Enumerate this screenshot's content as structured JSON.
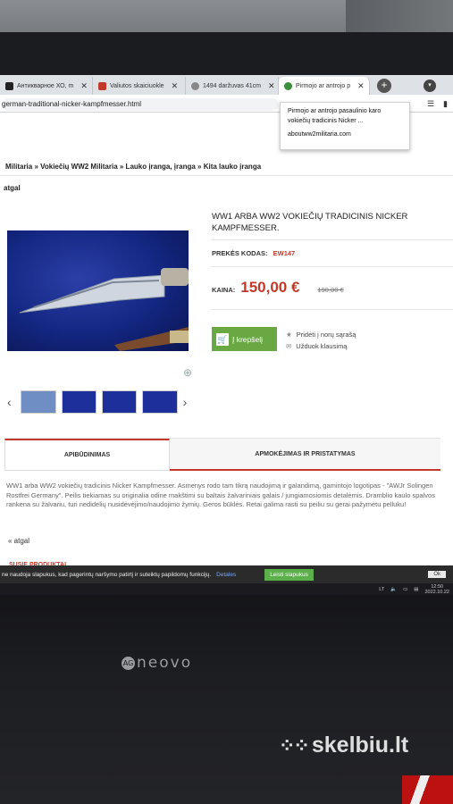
{
  "browser": {
    "tabs": [
      {
        "label": "Антикварное ХО, m",
        "color": "#333333",
        "active": false
      },
      {
        "label": "Valiutos skaiciuokle",
        "color": "#c0392b",
        "active": false
      },
      {
        "label": "1494 daržuvas 41cm",
        "color": "#666666",
        "active": false
      },
      {
        "label": "Pirmojo ar antrojo p",
        "color": "#3a8f3a",
        "active": true
      }
    ],
    "new_tab": "+",
    "url": "german-traditional-nicker-kampfmesser.html",
    "tooltip": {
      "title": "Pirmojo ar antrojo pasaulinio karo vokiečių tradicinis Nicker ...",
      "source": "aboutww2militaria.com"
    }
  },
  "page": {
    "breadcrumb": "Militaria » Vokiečių WW2 Militaria » Lauko įranga, įranga » Kita lauko įranga",
    "back_top": "atgal",
    "product": {
      "title": "WW1 ARBA WW2 VOKIEČIŲ TRADICINIS NICKER KAMPFMESSER.",
      "code_label": "PREKĖS KODAS:",
      "code": "EW147",
      "price_label": "KAINA:",
      "price": "150,00 €",
      "old_price": "190,00 €",
      "cart_button": "Į krepšelį",
      "wishlist": "Pridėti į norų sąrašą",
      "ask": "Užduok klausimą"
    },
    "tabs": {
      "description": "APIBŪDINIMAS",
      "payment": "APMOKĖJIMAS IR PRISTATYMAS"
    },
    "description": "WW1 arba WW2 vokiečių tradicinis Nicker Kampfmesser. Asmenys rodo tam tikrą naudojimą ir galandimą, gamintojo logotipas - \"AWJr Solingen Rostfrei Germany\". Peilis tiekiamas su originalia odine makštimi su baltais žalvariniais galais / jungiamosiomis detalėmis. Dramblio kaulo spalvos rankena su žalvariu, turi nedidelių nusidėvėjimo/naudojimo žymių. Geros būklės. Retai galima rasti su peiliu su gerai pažymėtu pelluku!",
    "back_bottom": "« atgal",
    "similar": "SUSIE PRODUKTAI"
  },
  "cookie": {
    "text": "ne naudoja slapukus, kad pagerintų naršymo patirtį ir suteiktų papildomų funkcijų.",
    "details": "Detales",
    "accept": "Leisti slapukus",
    "close": "Ok"
  },
  "taskbar": {
    "lang": "LT",
    "time": "12:50",
    "date": "2022.10.22"
  },
  "monitor": {
    "brand": "neovo",
    "brand_mark": "AG"
  },
  "watermark": "skelbiu.lt",
  "colors": {
    "accent_red": "#c0392b",
    "cart_green": "#6aa843",
    "cookie_green": "#5bb04a"
  }
}
